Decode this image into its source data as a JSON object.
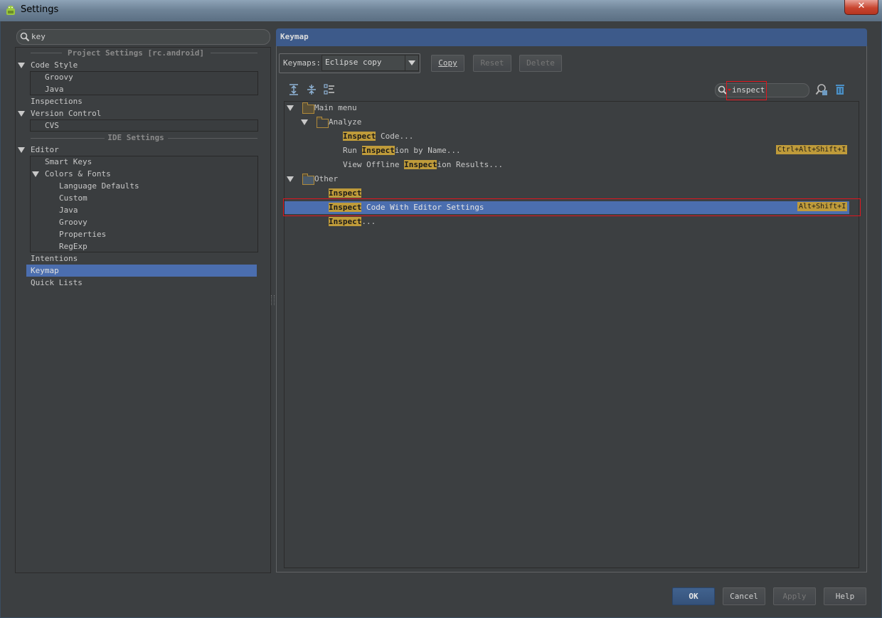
{
  "window": {
    "title": "Settings",
    "close_label": "✕"
  },
  "search": {
    "value": "key"
  },
  "left_tree": {
    "project_header": "Project Settings [rc.android]",
    "ide_header": "IDE Settings",
    "items": {
      "code_style": "Code Style",
      "groovy": "Groovy",
      "java": "Java",
      "inspections": "Inspections",
      "version_control": "Version Control",
      "cvs": "CVS",
      "editor": "Editor",
      "smart_keys": "Smart Keys",
      "colors_fonts": "Colors & Fonts",
      "language_defaults": "Language Defaults",
      "custom": "Custom",
      "java2": "Java",
      "groovy2": "Groovy",
      "properties": "Properties",
      "regexp": "RegExp",
      "intentions": "Intentions",
      "keymap": "Keymap",
      "quick_lists": "Quick Lists"
    }
  },
  "panel": {
    "title": "Keymap",
    "keymaps_label": "Keymaps:",
    "keymap_selected": "Eclipse copy",
    "copy_label": "Copy",
    "reset_label": "Reset",
    "delete_label": "Delete",
    "filter_value": "inspect"
  },
  "actions": {
    "main_menu": "Main menu",
    "analyze": "Analyze",
    "inspect_code": {
      "hl": "Inspect",
      "rest": " Code..."
    },
    "run_inspection": {
      "pre": "Run ",
      "hl": "Inspect",
      "rest": "ion by Name...",
      "shortcut": "Ctrl+Alt+Shift+I"
    },
    "view_offline": {
      "pre": "View Offline ",
      "hl": "Inspect",
      "rest": "ion Results..."
    },
    "other": "Other",
    "inspect": {
      "hl": "Inspect"
    },
    "inspect_editor": {
      "hl": "Inspect",
      "rest": " Code With Editor Settings",
      "shortcut": "Alt+Shift+I"
    },
    "inspect_dots": {
      "hl": "Inspect",
      "rest": "..."
    }
  },
  "footer": {
    "ok": "OK",
    "cancel": "Cancel",
    "apply": "Apply",
    "help": "Help"
  }
}
